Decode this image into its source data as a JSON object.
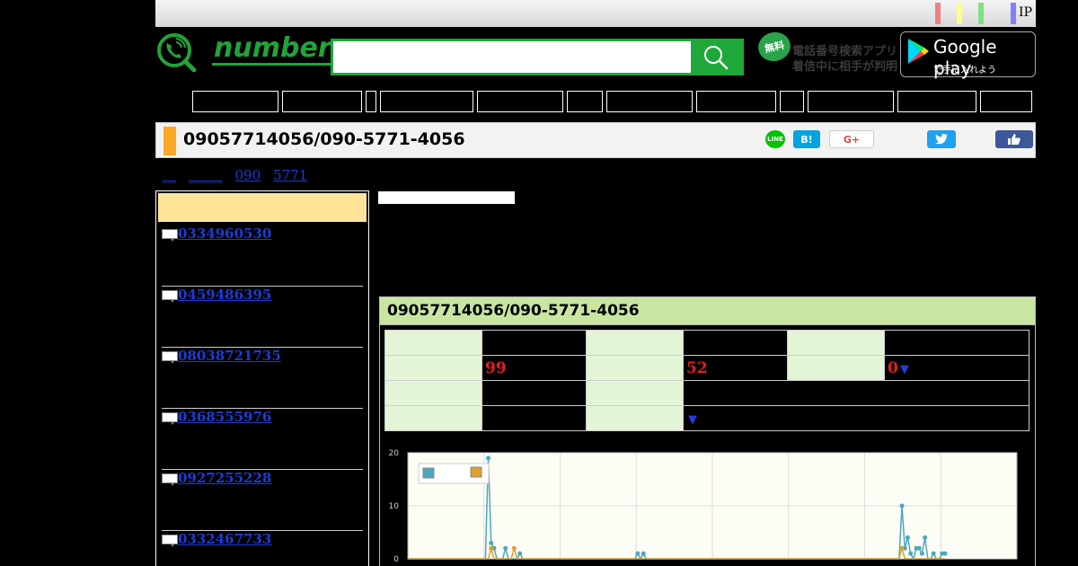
{
  "topbar": {
    "ip_label": "IP",
    "stripes": [
      "#f08080",
      "#ffff80",
      "#80e080",
      "#8080ff"
    ]
  },
  "header": {
    "logo_text": "number",
    "search_placeholder": "",
    "app_badge": "無料",
    "app_line1": "電話番号検索アプリ",
    "app_line2": "着信中に相手が判明",
    "gplay_title": "Google play",
    "gplay_sub": "で手に入れよう"
  },
  "nav": {
    "item_count": 12
  },
  "page": {
    "title": "09057714056/090-5771-4056"
  },
  "share": {
    "line": "LINE",
    "hatena": "B!",
    "gplus": "G+",
    "twitter": "t",
    "facebook": "like"
  },
  "breadcrumb": [
    "__",
    "_____",
    "090",
    "5771"
  ],
  "sidebar": {
    "items": [
      "0334960530",
      "0459486395",
      "08038721735",
      "0368555976",
      "0927255228",
      "0332467733"
    ]
  },
  "panel": {
    "title": "09057714056/090-5771-4056",
    "row2": {
      "c1": "99",
      "c2": "52",
      "c3": "0"
    },
    "arrow": "▼"
  },
  "chart_data": {
    "type": "line",
    "ylim": [
      0,
      20
    ],
    "yticks": [
      "20",
      "10",
      "0"
    ],
    "grid": true,
    "legend": "top-left",
    "colors": [
      "#4aa8c0",
      "#e0a030"
    ],
    "series": [
      {
        "values": [
          0,
          0,
          0,
          0,
          0,
          0,
          0,
          0,
          0,
          0,
          0,
          0,
          0,
          0,
          0,
          0,
          0,
          0,
          0,
          0,
          0,
          0,
          0,
          0,
          0,
          0,
          0,
          0,
          19,
          3,
          2,
          0,
          0,
          0,
          2,
          0,
          0,
          0,
          0,
          1,
          0,
          0,
          0,
          0,
          0,
          0,
          0,
          0,
          0,
          0,
          0,
          0,
          0,
          0,
          0,
          0,
          0,
          0,
          0,
          0,
          0,
          0,
          0,
          0,
          0,
          0,
          0,
          0,
          0,
          0,
          0,
          0,
          0,
          0,
          0,
          0,
          0,
          0,
          0,
          0,
          1,
          0,
          1,
          0,
          0,
          0,
          0,
          0,
          0,
          0,
          0,
          0,
          0,
          0,
          0,
          0,
          0,
          0,
          0,
          0,
          0,
          0,
          0,
          0,
          0,
          0,
          0,
          0,
          0,
          0,
          0,
          0,
          0,
          0,
          0,
          0,
          0,
          0,
          0,
          0,
          0,
          0,
          0,
          0,
          0,
          0,
          0,
          0,
          0,
          0,
          0,
          0,
          0,
          0,
          0,
          0,
          0,
          0,
          0,
          0,
          0,
          0,
          0,
          0,
          0,
          0,
          0,
          0,
          0,
          0,
          0,
          0,
          0,
          0,
          0,
          0,
          0,
          0,
          0,
          0,
          0,
          0,
          0,
          0,
          0,
          0,
          0,
          0,
          0,
          0,
          0,
          0,
          10,
          2,
          4,
          1,
          0,
          2,
          2,
          1,
          4,
          0,
          0,
          1,
          0,
          0,
          1,
          1
        ]
      },
      {
        "values": [
          0,
          0,
          0,
          0,
          0,
          0,
          0,
          0,
          0,
          0,
          0,
          0,
          0,
          0,
          0,
          0,
          0,
          0,
          0,
          0,
          0,
          0,
          0,
          0,
          0,
          0,
          0,
          0,
          0,
          2,
          0,
          0,
          0,
          0,
          0,
          0,
          0,
          2,
          0,
          0,
          0,
          0,
          0,
          0,
          0,
          0,
          0,
          0,
          0,
          0,
          0,
          0,
          0,
          0,
          0,
          0,
          0,
          0,
          0,
          0,
          0,
          0,
          0,
          0,
          0,
          0,
          0,
          0,
          0,
          0,
          0,
          0,
          0,
          0,
          0,
          0,
          0,
          0,
          0,
          0,
          0,
          0,
          0,
          0,
          0,
          0,
          0,
          0,
          0,
          0,
          0,
          0,
          0,
          0,
          0,
          0,
          0,
          0,
          0,
          0,
          0,
          0,
          0,
          0,
          0,
          0,
          0,
          0,
          0,
          0,
          0,
          0,
          0,
          0,
          0,
          0,
          0,
          0,
          0,
          0,
          0,
          0,
          0,
          0,
          0,
          0,
          0,
          0,
          0,
          0,
          0,
          0,
          0,
          0,
          0,
          0,
          0,
          0,
          0,
          0,
          0,
          0,
          0,
          0,
          0,
          0,
          0,
          0,
          0,
          0,
          0,
          0,
          0,
          0,
          0,
          0,
          0,
          0,
          0,
          0,
          0,
          0,
          0,
          0,
          0,
          0,
          0,
          0,
          0,
          0,
          0,
          0,
          2,
          0,
          0,
          0,
          0,
          0,
          0,
          0,
          0,
          0,
          0,
          0,
          0,
          0,
          0,
          0
        ]
      }
    ]
  }
}
